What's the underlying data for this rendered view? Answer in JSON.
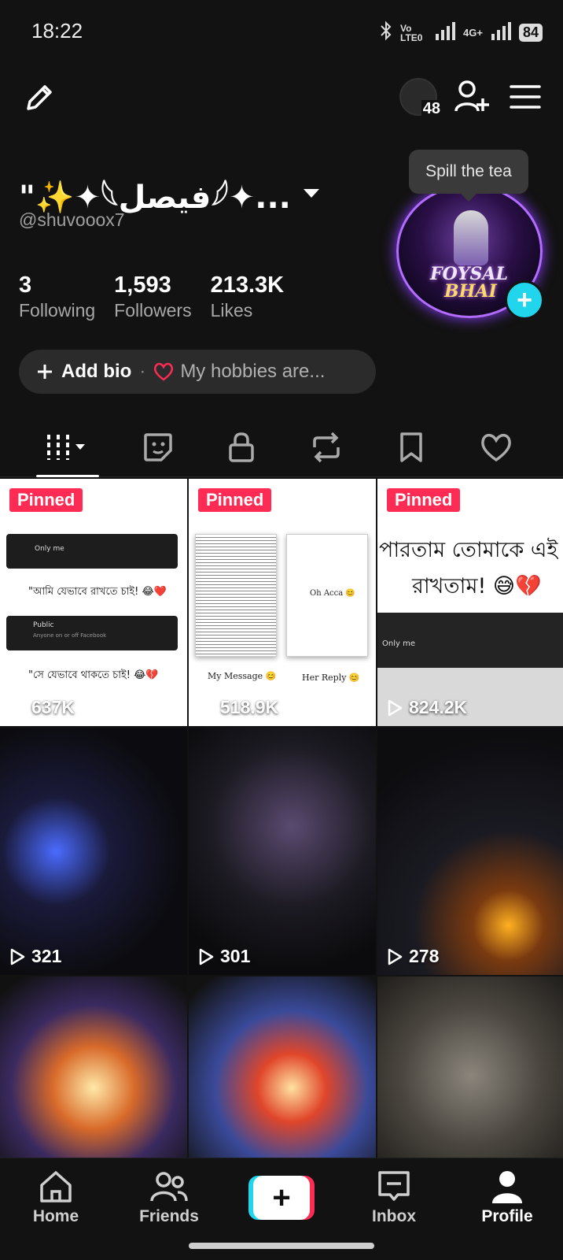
{
  "status_bar": {
    "time": "18:22",
    "signal_label": "Vo LTE0",
    "network": "4G+",
    "battery": "84"
  },
  "top_bar": {
    "notification_count": "48"
  },
  "profile": {
    "display_name": "\"✨✦𓆩فيصل𓆪✦...",
    "handle": "@shuvooox7",
    "tooltip": "Spill the tea",
    "avatar_brand_line1": "FOYSAL",
    "avatar_brand_line2": "BHAI",
    "stats": [
      {
        "value": "3",
        "label": "Following"
      },
      {
        "value": "1,593",
        "label": "Followers"
      },
      {
        "value": "213.3K",
        "label": "Likes"
      }
    ],
    "add_bio": "Add bio",
    "hobbies": "My hobbies are..."
  },
  "videos": [
    {
      "pinned": "Pinned",
      "views": "637K",
      "lines": [
        "Only me",
        "\"আমি যেভাবে রাখতে চাই! 😂❤️",
        "Public",
        "Anyone on or off Facebook",
        "\"সে যেভাবে থাকতে চাই! 😂💔"
      ]
    },
    {
      "pinned": "Pinned",
      "views": "518.9K",
      "lines": [
        "Oh Acca 😊",
        "My Message 😊",
        "Her Reply 😊"
      ]
    },
    {
      "pinned": "Pinned",
      "views": "824.2K",
      "lines": [
        "পারতাম তোমাকে এই",
        "রাখতাম! 😅💔",
        "Only me"
      ]
    },
    {
      "pinned": "",
      "views": "321"
    },
    {
      "pinned": "",
      "views": "301"
    },
    {
      "pinned": "",
      "views": "278"
    },
    {
      "pinned": "",
      "views": ""
    },
    {
      "pinned": "",
      "views": ""
    },
    {
      "pinned": "",
      "views": ""
    }
  ],
  "nav": {
    "home": "Home",
    "friends": "Friends",
    "inbox": "Inbox",
    "profile": "Profile"
  },
  "colors": {
    "accent_pink": "#fe2c55",
    "accent_cyan": "#20d5ec",
    "background": "#121212"
  }
}
